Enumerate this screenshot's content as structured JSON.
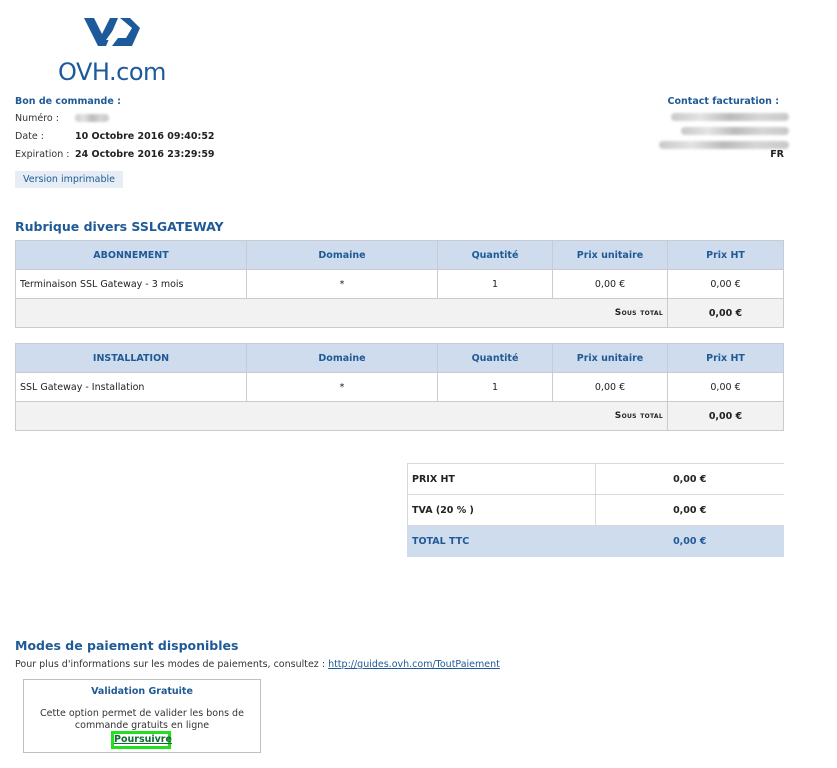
{
  "logo": {
    "brand": "OVH.com"
  },
  "order": {
    "title": "Bon de commande :",
    "number_label": "Numéro :",
    "date_label": "Date :",
    "date_value": "10 Octobre 2016 09:40:52",
    "expiration_label": "Expiration :",
    "expiration_value": "24 Octobre 2016 23:29:59",
    "print_button": "Version imprimable"
  },
  "billing": {
    "title": "Contact facturation :",
    "country": "FR"
  },
  "section_title": "Rubrique divers SSLGATEWAY",
  "subscription_table": {
    "headers": [
      "ABONNEMENT",
      "Domaine",
      "Quantité",
      "Prix unitaire",
      "Prix HT"
    ],
    "row": [
      "Terminaison SSL Gateway - 3 mois",
      "*",
      "1",
      "0,00 €",
      "0,00 €"
    ],
    "subtotal_label": "Sous total",
    "subtotal_value": "0,00 €"
  },
  "installation_table": {
    "headers": [
      "INSTALLATION",
      "Domaine",
      "Quantité",
      "Prix unitaire",
      "Prix HT"
    ],
    "row": [
      "SSL Gateway - Installation",
      "*",
      "1",
      "0,00 €",
      "0,00 €"
    ],
    "subtotal_label": "Sous total",
    "subtotal_value": "0,00 €"
  },
  "totals": {
    "rows": [
      {
        "label": "PRIX HT",
        "value": "0,00 €"
      },
      {
        "label": "TVA (20 % )",
        "value": "0,00 €"
      },
      {
        "label": "TOTAL TTC",
        "value": "0,00 €"
      }
    ]
  },
  "payment": {
    "title": "Modes de paiement disponibles",
    "info": "Pour plus d'informations sur les modes de paiements, consultez :",
    "link": "http://guides.ovh.com/ToutPaiement",
    "box_title": "Validation Gratuite",
    "box_desc": "Cette option permet de valider les bons de commande gratuits en ligne",
    "continue_button": "Poursuivre"
  },
  "colors": {
    "accent": "#1f5a96",
    "header_bg": "#cfdced",
    "highlight": "#22e01f"
  }
}
